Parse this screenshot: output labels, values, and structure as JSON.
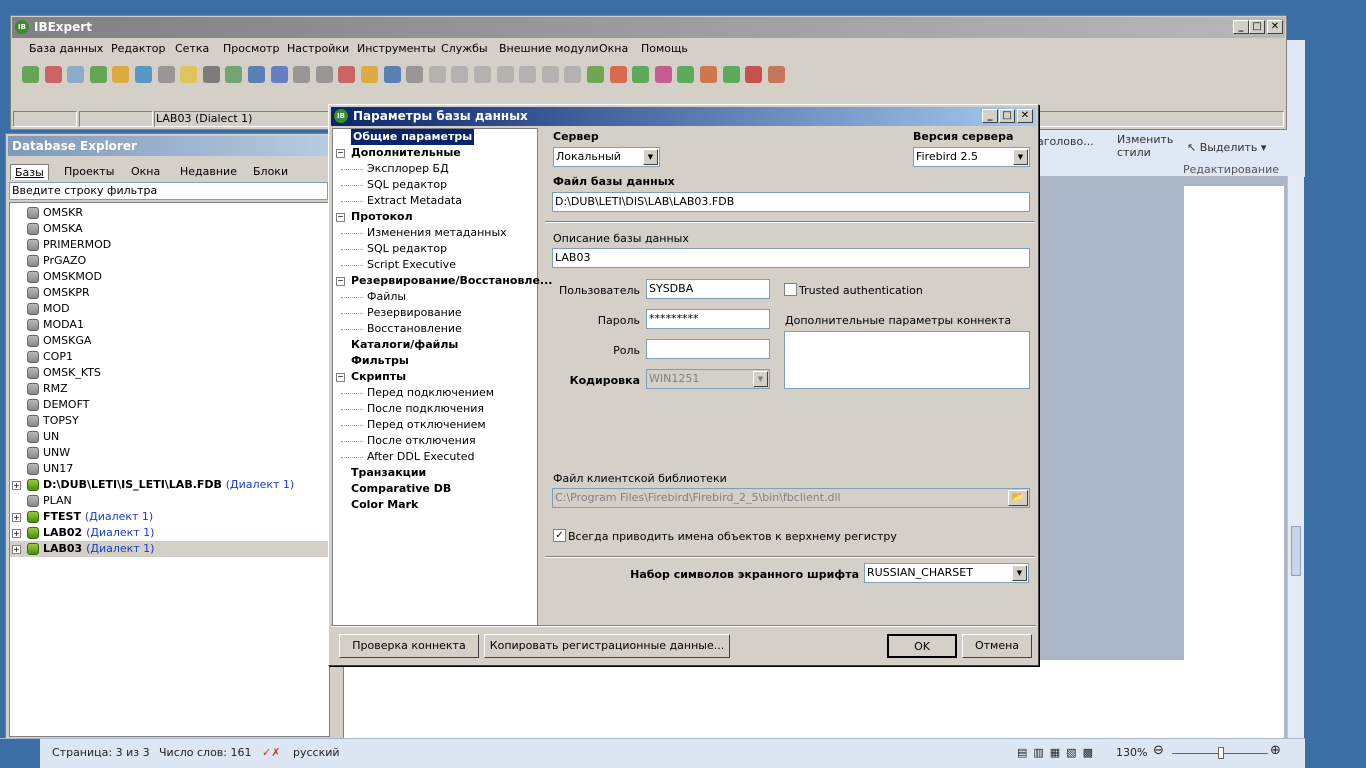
{
  "ibexpert": {
    "title": "IBExpert",
    "menu": [
      "База данных",
      "Редактор",
      "Сетка",
      "Просмотр",
      "Настройки",
      "Инструменты",
      "Службы",
      "Внешние модули",
      "Окна",
      "Помощь"
    ],
    "connection_status": "LAB03 (Dialect 1)"
  },
  "explorer": {
    "title": "Database Explorer",
    "tabs": [
      "Базы",
      "Проекты",
      "Окна",
      "Недавние",
      "Блоки"
    ],
    "filter_placeholder": "Введите строку фильтра",
    "items": [
      {
        "name": "OMSKR"
      },
      {
        "name": "OMSKA"
      },
      {
        "name": "PRIMERMOD"
      },
      {
        "name": "PrGAZO"
      },
      {
        "name": "OMSKMOD"
      },
      {
        "name": "OMSKPR"
      },
      {
        "name": "MOD"
      },
      {
        "name": "MODA1"
      },
      {
        "name": "OMSKGA"
      },
      {
        "name": "COP1"
      },
      {
        "name": "OMSK_KTS"
      },
      {
        "name": "RMZ"
      },
      {
        "name": "DEMOFT"
      },
      {
        "name": "TOPSY"
      },
      {
        "name": "UN"
      },
      {
        "name": "UNW"
      },
      {
        "name": "UN17"
      }
    ],
    "registered": [
      {
        "name": "D:\\DUB\\LETI\\IS_LETI\\LAB.FDB",
        "dialect": "(Диалект 1)"
      },
      {
        "name": "PLAN",
        "dialect": ""
      },
      {
        "name": "FTEST",
        "dialect": "(Диалект 1)"
      },
      {
        "name": "LAB02",
        "dialect": "(Диалект 1)"
      },
      {
        "name": "LAB03",
        "dialect": "(Диалект 1)"
      }
    ]
  },
  "dialog": {
    "title": "Параметры базы данных",
    "nav": [
      {
        "label": "Общие параметры",
        "level": 0,
        "bold": true,
        "selected": true
      },
      {
        "label": "Дополнительные",
        "level": 0,
        "bold": true,
        "expander": true
      },
      {
        "label": "Эксплорер БД",
        "level": 1
      },
      {
        "label": "SQL редактор",
        "level": 1
      },
      {
        "label": "Extract Metadata",
        "level": 1
      },
      {
        "label": "Протокол",
        "level": 0,
        "bold": true,
        "expander": true
      },
      {
        "label": "Изменения метаданных",
        "level": 1
      },
      {
        "label": "SQL редактор",
        "level": 1
      },
      {
        "label": "Script Executive",
        "level": 1
      },
      {
        "label": "Резервирование/Восстановле...",
        "level": 0,
        "bold": true,
        "expander": true
      },
      {
        "label": "Файлы",
        "level": 1
      },
      {
        "label": "Резервирование",
        "level": 1
      },
      {
        "label": "Восстановление",
        "level": 1
      },
      {
        "label": "Каталоги/файлы",
        "level": 0,
        "bold": true
      },
      {
        "label": "Фильтры",
        "level": 0,
        "bold": true
      },
      {
        "label": "Скрипты",
        "level": 0,
        "bold": true,
        "expander": true
      },
      {
        "label": "Перед подключением",
        "level": 1
      },
      {
        "label": "После подключения",
        "level": 1
      },
      {
        "label": "Перед отключением",
        "level": 1
      },
      {
        "label": "После отключения",
        "level": 1
      },
      {
        "label": "After DDL Executed",
        "level": 1
      },
      {
        "label": "Транзакции",
        "level": 0,
        "bold": true
      },
      {
        "label": "Comparative DB",
        "level": 0,
        "bold": true
      },
      {
        "label": "Color Mark",
        "level": 0,
        "bold": true
      }
    ],
    "server_label": "Сервер",
    "server_value": "Локальный",
    "version_label": "Версия сервера",
    "version_value": "Firebird 2.5",
    "dbfile_label": "Файл базы данных",
    "dbfile_value": "D:\\DUB\\LETI\\DIS\\LAB\\LAB03.FDB",
    "desc_label": "Описание базы данных",
    "desc_value": "LAB03",
    "user_label": "Пользователь",
    "user_value": "SYSDBA",
    "trusted_label": "Trusted authentication",
    "password_label": "Пароль",
    "password_value": "*********",
    "extra_params_label": "Дополнительные параметры коннекта",
    "role_label": "Роль",
    "role_value": "",
    "charset_label": "Кодировка",
    "charset_value": "WIN1251",
    "client_lib_label": "Файл клиентской библиотеки",
    "client_lib_value": "C:\\Program Files\\Firebird\\Firebird_2_5\\bin\\fbclient.dll",
    "uppercase_label": "Всегда приводить имена объектов к верхнему регистру",
    "font_charset_label": "Набор символов экранного шрифта",
    "font_charset_value": "RUSSIAN_CHARSET",
    "btn_test": "Проверка коннекта",
    "btn_copy": "Копировать регистрационные данные...",
    "btn_ok": "OK",
    "btn_cancel": "Отмена"
  },
  "word": {
    "ribbon_styles_fragment": "аголово...",
    "change_styles": "Изменить стили",
    "select": "Выделить",
    "editing": "Редактирование",
    "status_page": "Страница: 3 из 3",
    "status_words": "Число слов: 161",
    "status_lang": "русский",
    "zoom": "130%"
  },
  "colors": {
    "dialog_title": "#0a246a",
    "selection": "#0a246a",
    "dialect_link": "#1b3dc6",
    "desktop": "#3a6ea5"
  }
}
